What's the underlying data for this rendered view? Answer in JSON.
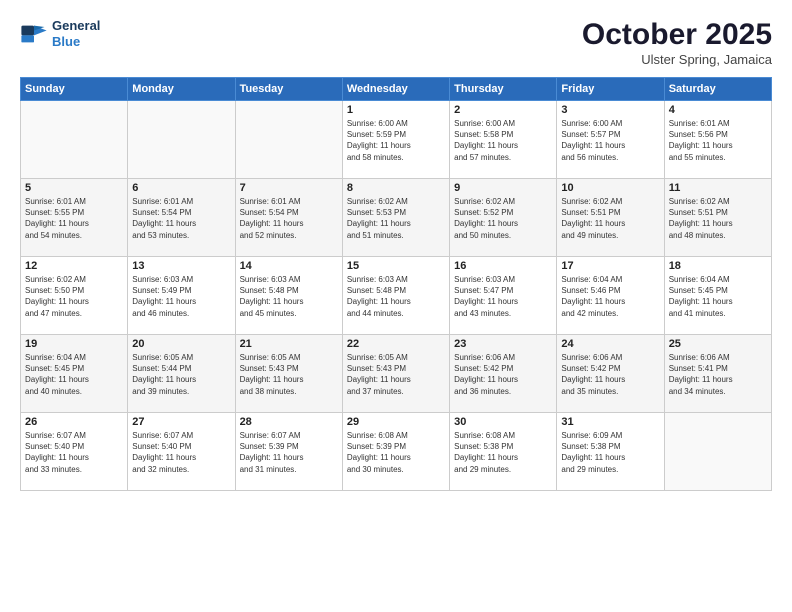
{
  "header": {
    "logo_line1": "General",
    "logo_line2": "Blue",
    "title": "October 2025",
    "location": "Ulster Spring, Jamaica"
  },
  "weekdays": [
    "Sunday",
    "Monday",
    "Tuesday",
    "Wednesday",
    "Thursday",
    "Friday",
    "Saturday"
  ],
  "weeks": [
    [
      {
        "day": "",
        "info": ""
      },
      {
        "day": "",
        "info": ""
      },
      {
        "day": "",
        "info": ""
      },
      {
        "day": "1",
        "info": "Sunrise: 6:00 AM\nSunset: 5:59 PM\nDaylight: 11 hours\nand 58 minutes."
      },
      {
        "day": "2",
        "info": "Sunrise: 6:00 AM\nSunset: 5:58 PM\nDaylight: 11 hours\nand 57 minutes."
      },
      {
        "day": "3",
        "info": "Sunrise: 6:00 AM\nSunset: 5:57 PM\nDaylight: 11 hours\nand 56 minutes."
      },
      {
        "day": "4",
        "info": "Sunrise: 6:01 AM\nSunset: 5:56 PM\nDaylight: 11 hours\nand 55 minutes."
      }
    ],
    [
      {
        "day": "5",
        "info": "Sunrise: 6:01 AM\nSunset: 5:55 PM\nDaylight: 11 hours\nand 54 minutes."
      },
      {
        "day": "6",
        "info": "Sunrise: 6:01 AM\nSunset: 5:54 PM\nDaylight: 11 hours\nand 53 minutes."
      },
      {
        "day": "7",
        "info": "Sunrise: 6:01 AM\nSunset: 5:54 PM\nDaylight: 11 hours\nand 52 minutes."
      },
      {
        "day": "8",
        "info": "Sunrise: 6:02 AM\nSunset: 5:53 PM\nDaylight: 11 hours\nand 51 minutes."
      },
      {
        "day": "9",
        "info": "Sunrise: 6:02 AM\nSunset: 5:52 PM\nDaylight: 11 hours\nand 50 minutes."
      },
      {
        "day": "10",
        "info": "Sunrise: 6:02 AM\nSunset: 5:51 PM\nDaylight: 11 hours\nand 49 minutes."
      },
      {
        "day": "11",
        "info": "Sunrise: 6:02 AM\nSunset: 5:51 PM\nDaylight: 11 hours\nand 48 minutes."
      }
    ],
    [
      {
        "day": "12",
        "info": "Sunrise: 6:02 AM\nSunset: 5:50 PM\nDaylight: 11 hours\nand 47 minutes."
      },
      {
        "day": "13",
        "info": "Sunrise: 6:03 AM\nSunset: 5:49 PM\nDaylight: 11 hours\nand 46 minutes."
      },
      {
        "day": "14",
        "info": "Sunrise: 6:03 AM\nSunset: 5:48 PM\nDaylight: 11 hours\nand 45 minutes."
      },
      {
        "day": "15",
        "info": "Sunrise: 6:03 AM\nSunset: 5:48 PM\nDaylight: 11 hours\nand 44 minutes."
      },
      {
        "day": "16",
        "info": "Sunrise: 6:03 AM\nSunset: 5:47 PM\nDaylight: 11 hours\nand 43 minutes."
      },
      {
        "day": "17",
        "info": "Sunrise: 6:04 AM\nSunset: 5:46 PM\nDaylight: 11 hours\nand 42 minutes."
      },
      {
        "day": "18",
        "info": "Sunrise: 6:04 AM\nSunset: 5:45 PM\nDaylight: 11 hours\nand 41 minutes."
      }
    ],
    [
      {
        "day": "19",
        "info": "Sunrise: 6:04 AM\nSunset: 5:45 PM\nDaylight: 11 hours\nand 40 minutes."
      },
      {
        "day": "20",
        "info": "Sunrise: 6:05 AM\nSunset: 5:44 PM\nDaylight: 11 hours\nand 39 minutes."
      },
      {
        "day": "21",
        "info": "Sunrise: 6:05 AM\nSunset: 5:43 PM\nDaylight: 11 hours\nand 38 minutes."
      },
      {
        "day": "22",
        "info": "Sunrise: 6:05 AM\nSunset: 5:43 PM\nDaylight: 11 hours\nand 37 minutes."
      },
      {
        "day": "23",
        "info": "Sunrise: 6:06 AM\nSunset: 5:42 PM\nDaylight: 11 hours\nand 36 minutes."
      },
      {
        "day": "24",
        "info": "Sunrise: 6:06 AM\nSunset: 5:42 PM\nDaylight: 11 hours\nand 35 minutes."
      },
      {
        "day": "25",
        "info": "Sunrise: 6:06 AM\nSunset: 5:41 PM\nDaylight: 11 hours\nand 34 minutes."
      }
    ],
    [
      {
        "day": "26",
        "info": "Sunrise: 6:07 AM\nSunset: 5:40 PM\nDaylight: 11 hours\nand 33 minutes."
      },
      {
        "day": "27",
        "info": "Sunrise: 6:07 AM\nSunset: 5:40 PM\nDaylight: 11 hours\nand 32 minutes."
      },
      {
        "day": "28",
        "info": "Sunrise: 6:07 AM\nSunset: 5:39 PM\nDaylight: 11 hours\nand 31 minutes."
      },
      {
        "day": "29",
        "info": "Sunrise: 6:08 AM\nSunset: 5:39 PM\nDaylight: 11 hours\nand 30 minutes."
      },
      {
        "day": "30",
        "info": "Sunrise: 6:08 AM\nSunset: 5:38 PM\nDaylight: 11 hours\nand 29 minutes."
      },
      {
        "day": "31",
        "info": "Sunrise: 6:09 AM\nSunset: 5:38 PM\nDaylight: 11 hours\nand 29 minutes."
      },
      {
        "day": "",
        "info": ""
      }
    ]
  ]
}
